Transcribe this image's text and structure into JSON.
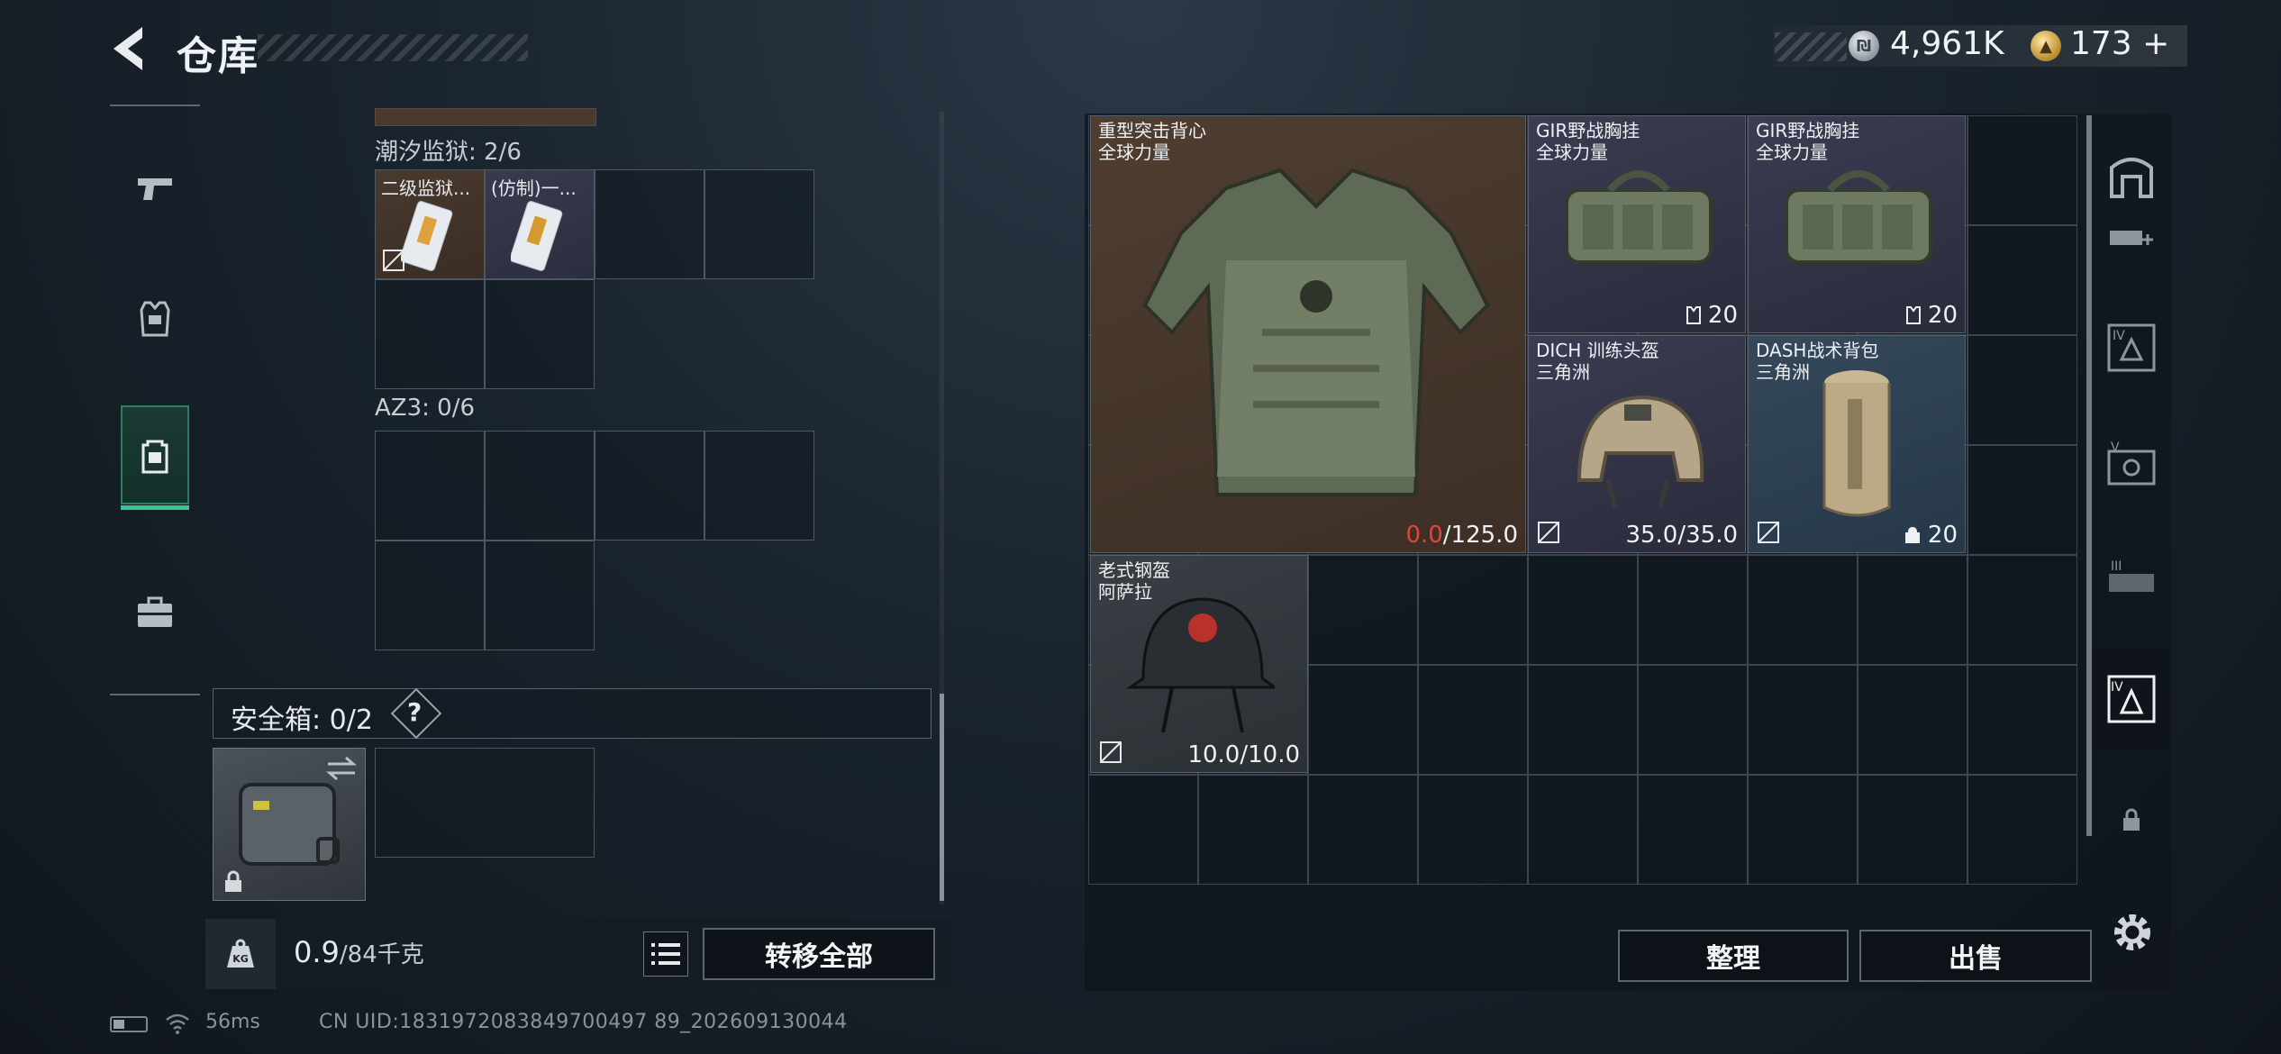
{
  "header": {
    "title": "仓库",
    "silver_amount": "4,961K",
    "gold_amount": "173",
    "gold_plus": "+"
  },
  "left_rail": {
    "items": [
      {
        "name": "weapons",
        "icon": "pistol-icon"
      },
      {
        "name": "armor",
        "icon": "vest-icon"
      },
      {
        "name": "backpack",
        "icon": "backpack-icon",
        "active": true
      },
      {
        "name": "case",
        "icon": "briefcase-icon"
      }
    ]
  },
  "containers": {
    "grid1": {
      "label": "潮汐监狱: 2/6",
      "items": [
        {
          "label": "二级监狱..."
        },
        {
          "label": "(仿制)一..."
        }
      ]
    },
    "grid2": {
      "label": "AZ3: 0/6"
    }
  },
  "safe_box": {
    "label": "安全箱: 0/2",
    "help": "?"
  },
  "weight": {
    "current": "0.9",
    "max": "/84千克"
  },
  "actions": {
    "transfer_all": "转移全部",
    "sort": "整理",
    "sell": "出售"
  },
  "stash_items": [
    {
      "name": "重型突击背心",
      "sub": "全球力量",
      "dur_cur": "0.0",
      "dur_max": "/125.0",
      "color": "#e2433b"
    },
    {
      "name": "GIR野战胸挂",
      "sub": "全球力量",
      "capacity": "20"
    },
    {
      "name": "GIR野战胸挂",
      "sub": "全球力量",
      "capacity": "20"
    },
    {
      "name": "DICH 训练头盔",
      "sub": "三角洲",
      "durability": "35.0/35.0"
    },
    {
      "name": "DASH战术背包",
      "sub": "三角洲",
      "capacity": "20"
    },
    {
      "name": "老式钢盔",
      "sub": "阿萨拉",
      "durability": "10.0/10.0"
    }
  ],
  "right_rail": {
    "items": [
      {
        "icon": "home-icon"
      },
      {
        "icon": "sort-add-icon"
      },
      {
        "icon": "tier4-filter-icon"
      },
      {
        "icon": "tier5-filter-icon"
      },
      {
        "icon": "tier3-filter-icon"
      },
      {
        "icon": "tier4-selected-icon",
        "selected": true
      },
      {
        "icon": "lock-icon"
      }
    ]
  },
  "footer": {
    "ping": "56ms",
    "uid": "CN UID:1831972083849700497 89_202609130044"
  }
}
